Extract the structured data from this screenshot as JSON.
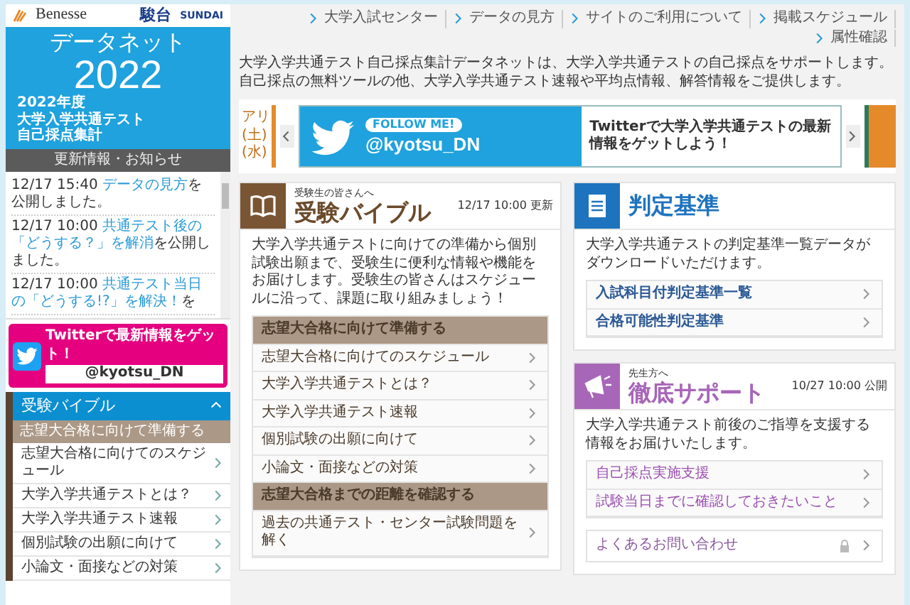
{
  "sidebar": {
    "partner_logos": {
      "benesse": "Benesse",
      "sundai_kanji": "駿台",
      "sundai_latin": "SUNDAI"
    },
    "site_logo": {
      "name": "データネット",
      "year": "2022",
      "caption": [
        "2022年度",
        "大学入学共通テスト",
        "自己採点集計"
      ]
    },
    "news_heading": "更新情報・お知らせ",
    "news": [
      {
        "time": "12/17 15:40",
        "link": "データの見方",
        "rest": "を公開しました。"
      },
      {
        "time": "12/17 10:00",
        "link": "共通テスト後の「どうする？」を解消",
        "rest": "を公開しました。"
      },
      {
        "time": "12/17 10:00",
        "link": "共通テスト当日の「どうする!?」を解決！",
        "rest": "を"
      }
    ],
    "twitter_banner": {
      "text": "Twitterで最新情報をゲット！",
      "handle": "@kyotsu_DN"
    },
    "menu": {
      "title": "受験バイブル",
      "expanded": true,
      "items": [
        {
          "kind": "heading",
          "label": "志望大合格に向けて準備する"
        },
        {
          "kind": "link",
          "label": "志望大合格に向けてのスケジュール"
        },
        {
          "kind": "link",
          "label": "大学入学共通テストとは？"
        },
        {
          "kind": "link",
          "label": "大学入学共通テスト速報"
        },
        {
          "kind": "link",
          "label": "個別試験の出願に向けて"
        },
        {
          "kind": "link",
          "label": "小論文・面接などの対策"
        }
      ]
    }
  },
  "nav_links": [
    "大学入試センター",
    "データの見方",
    "サイトのご利用について",
    "掲載スケジュール",
    "属性確認"
  ],
  "intro": "大学入学共通テスト自己採点集計データネットは、大学入学共通テストの自己採点をサポートします。自己採点の無料ツールの他、大学入学共通テスト速報や平均点情報、解答情報をご提供します。",
  "carousel": {
    "prev_slide_fragments": [
      "アリ",
      "(土)",
      "(水)"
    ],
    "slide": {
      "badge": "FOLLOW ME!",
      "handle": "@kyotsu_DN",
      "text": "Twitterで大学入学共通テストの最新情報をゲットしよう！"
    }
  },
  "bible_card": {
    "kicker": "受験生の皆さんへ",
    "title": "受験バイブル",
    "date": "12/17 10:00 更新",
    "description": "大学入学共通テストに向けての準備から個別試験出願まで、受験生に便利な情報や機能をお届けします。受験生の皆さんはスケジュールに沿って、課題に取り組みましょう！",
    "items": [
      {
        "kind": "heading",
        "label": "志望大合格に向けて準備する"
      },
      {
        "kind": "link",
        "label": "志望大合格に向けてのスケジュール"
      },
      {
        "kind": "link",
        "label": "大学入学共通テストとは？"
      },
      {
        "kind": "link",
        "label": "大学入学共通テスト速報"
      },
      {
        "kind": "link",
        "label": "個別試験の出願に向けて"
      },
      {
        "kind": "link",
        "label": "小論文・面接などの対策"
      },
      {
        "kind": "heading",
        "label": "志望大合格までの距離を確認する"
      },
      {
        "kind": "link",
        "label": "過去の共通テスト・センター試験問題を解く"
      }
    ]
  },
  "judge_card": {
    "title": "判定基準",
    "description": "大学入学共通テストの判定基準一覧データがダウンロードいただけます。",
    "items": [
      "入試科目付判定基準一覧",
      "合格可能性判定基準"
    ]
  },
  "support_card": {
    "kicker": "先生方へ",
    "title": "徹底サポート",
    "date": "10/27 10:00 公開",
    "description": "大学入学共通テスト前後のご指導を支援する情報をお届けいたします。",
    "items": [
      "自己採点実施支援",
      "試験当日までに確認しておきたいこと"
    ]
  },
  "faq_link": "よくあるお問い合わせ"
}
